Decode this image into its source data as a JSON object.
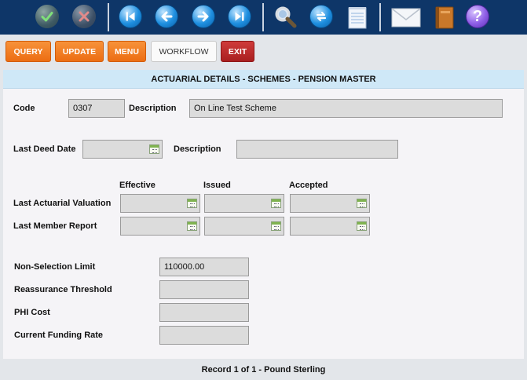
{
  "toolbar": {
    "icons": [
      "confirm-icon",
      "cancel-icon",
      "first-record-icon",
      "previous-record-icon",
      "next-record-icon",
      "last-record-icon",
      "search-icon",
      "refresh-icon",
      "notepad-icon",
      "mail-icon",
      "book-icon",
      "help-icon"
    ]
  },
  "actions": {
    "query": "QUERY",
    "update": "UPDATE",
    "menu": "MENU",
    "workflow": "WORKFLOW",
    "exit": "EXIT"
  },
  "panel": {
    "title": "ACTUARIAL DETAILS - SCHEMES - PENSION MASTER"
  },
  "form": {
    "code_label": "Code",
    "code_value": "0307",
    "description_label": "Description",
    "description_value": "On Line Test Scheme",
    "last_deed_date_label": "Last Deed Date",
    "last_deed_date_value": "",
    "deed_description_label": "Description",
    "deed_description_value": "",
    "col_effective": "Effective",
    "col_issued": "Issued",
    "col_accepted": "Accepted",
    "last_actuarial_valuation_label": "Last Actuarial Valuation",
    "last_member_report_label": "Last Member Report",
    "non_selection_limit_label": "Non-Selection Limit",
    "non_selection_limit_value": "110000.00",
    "reassurance_threshold_label": "Reassurance Threshold",
    "reassurance_threshold_value": "",
    "phi_cost_label": "PHI Cost",
    "phi_cost_value": "",
    "current_funding_rate_label": "Current Funding Rate",
    "current_funding_rate_value": ""
  },
  "status": {
    "text": "Record 1 of 1 - Pound Sterling"
  },
  "colors": {
    "toolbar_bg": "#0e3668",
    "action_orange": "#ec6d12",
    "exit_red": "#a91f1f",
    "title_bar": "#cfe8f7"
  }
}
